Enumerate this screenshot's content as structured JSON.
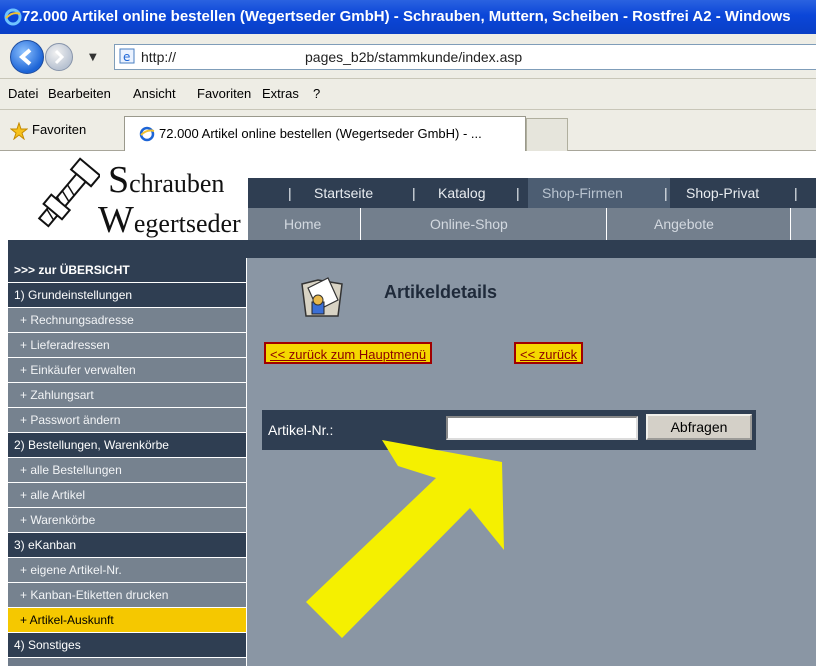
{
  "window": {
    "title": "72.000 Artikel online bestellen (Wegertseder GmbH) - Schrauben, Muttern, Scheiben - Rostfrei A2 - Windows"
  },
  "address_bar": {
    "scheme": "http://",
    "path": "pages_b2b/stammkunde/index.asp"
  },
  "menu": [
    "Datei",
    "Bearbeiten",
    "Ansicht",
    "Favoriten",
    "Extras",
    "?"
  ],
  "favorites_bar": {
    "label": "Favoriten",
    "tab_title": "72.000 Artikel online bestellen (Wegertseder GmbH) - ..."
  },
  "logo": {
    "line1_initial": "S",
    "line1_rest": "chrauben",
    "line2_initial": "W",
    "line2_rest": "egertseder"
  },
  "top_nav": [
    {
      "label": "Startseite"
    },
    {
      "label": "Katalog"
    },
    {
      "label": "Shop-Firmen",
      "active": true
    },
    {
      "label": "Shop-Privat"
    }
  ],
  "sub_nav": [
    {
      "label": "Home"
    },
    {
      "label": "Online-Shop"
    },
    {
      "label": "Angebote"
    }
  ],
  "sidebar": {
    "overview": ">>> zur ÜBERSICHT",
    "items": [
      {
        "type": "head",
        "label": "1)  Grundeinstellungen"
      },
      {
        "type": "sub",
        "label": "+   Rechnungsadresse"
      },
      {
        "type": "sub",
        "label": "+   Lieferadressen"
      },
      {
        "type": "sub",
        "label": "+   Einkäufer verwalten"
      },
      {
        "type": "sub",
        "label": "+   Zahlungsart"
      },
      {
        "type": "sub",
        "label": "+   Passwort ändern"
      },
      {
        "type": "head",
        "label": "2)  Bestellungen, Warenkörbe"
      },
      {
        "type": "sub",
        "label": "+   alle Bestellungen"
      },
      {
        "type": "sub",
        "label": "+   alle Artikel"
      },
      {
        "type": "sub",
        "label": "+   Warenkörbe"
      },
      {
        "type": "head",
        "label": "3)  eKanban"
      },
      {
        "type": "sub",
        "label": "+   eigene Artikel-Nr."
      },
      {
        "type": "sub",
        "label": "+   Kanban-Etiketten drucken"
      },
      {
        "type": "sub",
        "label": "+   Artikel-Auskunft",
        "active": true
      },
      {
        "type": "head",
        "label": "4)  Sonstiges"
      }
    ]
  },
  "main": {
    "heading": "Artikeldetails",
    "back_main_label": "<< zurück zum Hauptmenü",
    "back_label": "<< zurück",
    "form": {
      "label": "Artikel-Nr.:",
      "input_value": "",
      "submit_label": "Abfragen"
    }
  },
  "colors": {
    "nav_dark": "#2f3e52",
    "sidebar_bg": "#6f7b8a",
    "content_bg": "#8a96a4",
    "highlight": "#f5c800",
    "arrow": "#f5f000"
  }
}
